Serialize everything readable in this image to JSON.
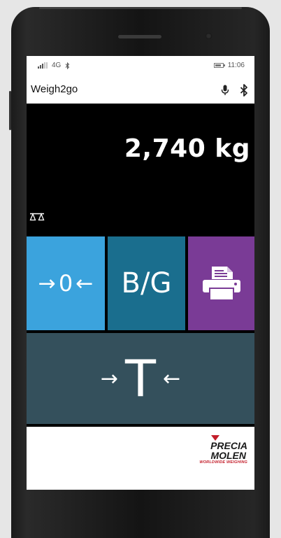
{
  "status_bar": {
    "network": "4G",
    "time": "11:06"
  },
  "app": {
    "title": "Weigh2go"
  },
  "weight": {
    "reading": "2,740 kg"
  },
  "buttons": {
    "zero_label": "0",
    "gross_net_label": "B/G",
    "tare_label": "T"
  },
  "logo": {
    "line1": "PRECIA",
    "line2": "MOLEN",
    "tagline": "WORLDWIDE WEIGHING"
  },
  "colors": {
    "zero_tile": "#3ba3dd",
    "gross_net_tile": "#1a6e8e",
    "print_tile": "#7a3b96",
    "tare_tile": "#34505c",
    "logo_accent": "#c31d2a"
  },
  "icons": [
    "signal-icon",
    "bluetooth-icon",
    "battery-icon",
    "microphone-icon",
    "scale-icon",
    "printer-icon",
    "precia-molen-logo"
  ]
}
